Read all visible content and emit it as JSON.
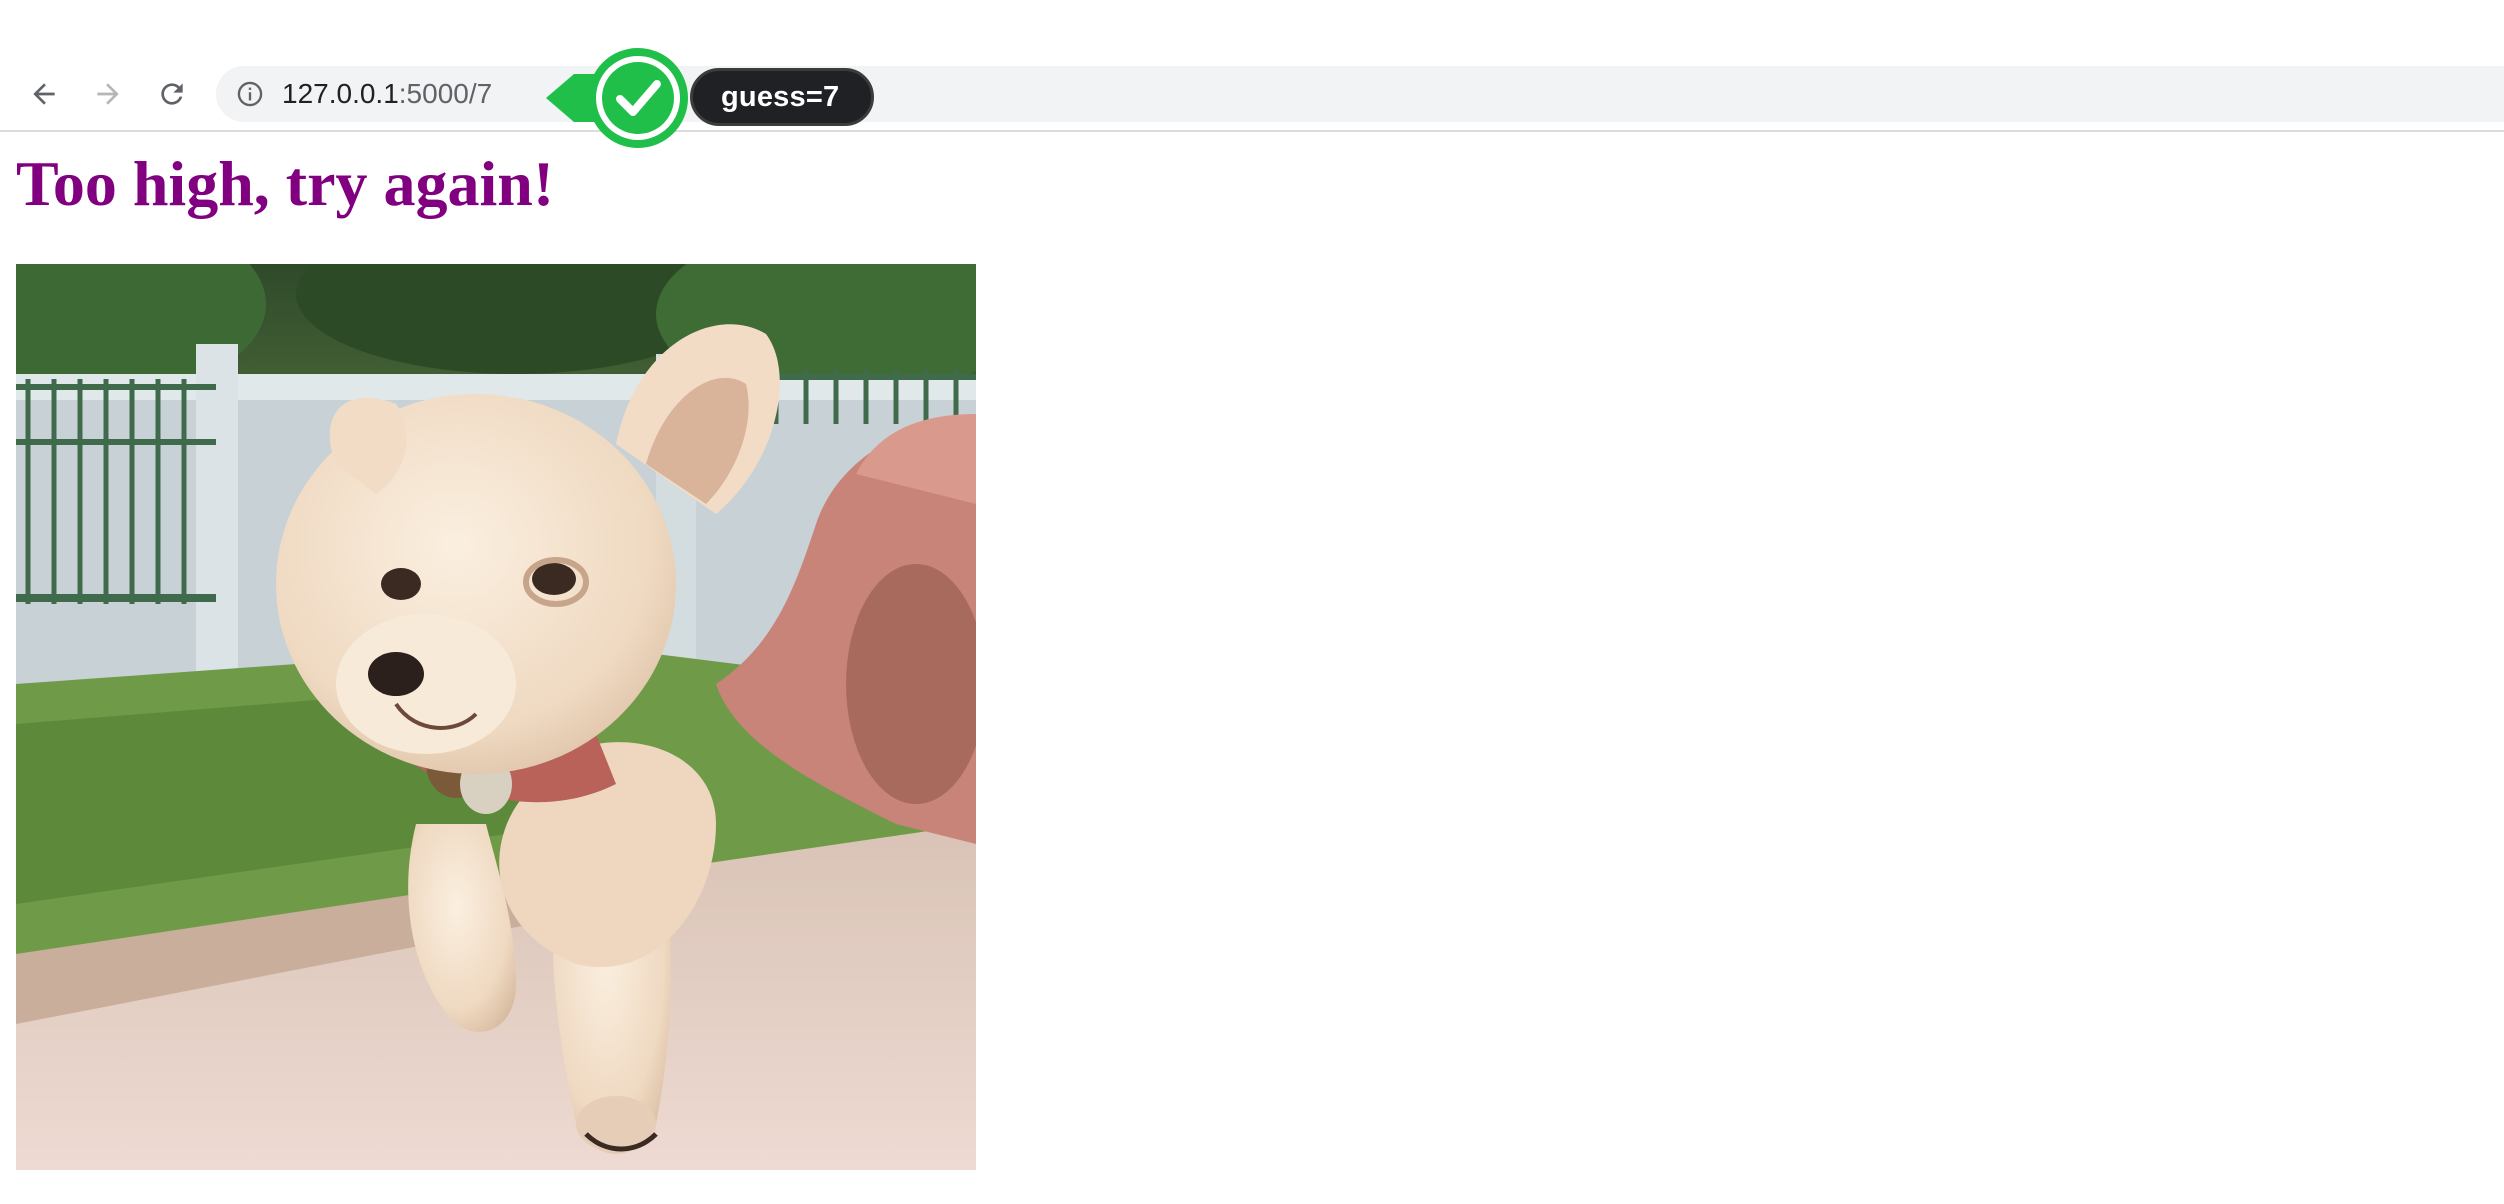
{
  "browser": {
    "url_host": "127.0.0.1",
    "url_rest": ":5000/7",
    "back_icon": "arrow-left-icon",
    "forward_icon": "arrow-right-icon",
    "reload_icon": "reload-icon",
    "info_icon": "info-circle-icon"
  },
  "overlay": {
    "check_icon": "checkmark-icon",
    "guess_label": "guess=7",
    "check_color": "#1fbf4a"
  },
  "page": {
    "heading": "Too high, try again!",
    "heading_color": "#800080",
    "image_subject": "puppy being carried outdoors"
  }
}
